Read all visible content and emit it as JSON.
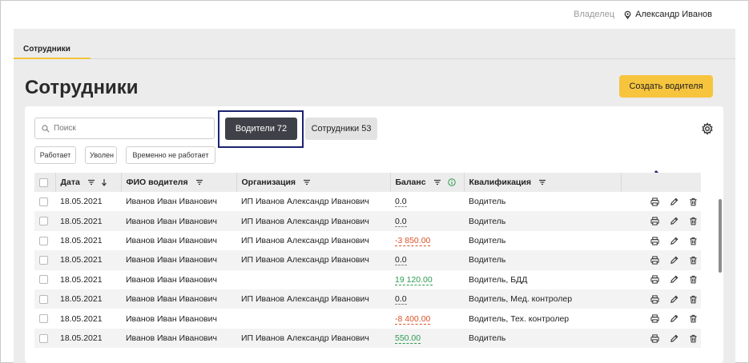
{
  "header": {
    "role": "Владелец",
    "user_name": "Александр Иванов"
  },
  "tabs": {
    "active_label": "Сотрудники"
  },
  "page": {
    "title": "Сотрудники",
    "create_label": "Создать водителя"
  },
  "search": {
    "placeholder": "Поиск"
  },
  "segments": {
    "drivers": "Водители 72",
    "staff": "Сотрудники 53"
  },
  "filters": [
    "Работает",
    "Уволен",
    "Временно не работает"
  ],
  "table": {
    "columns": [
      "Дата",
      "ФИО водителя",
      "Организация",
      "Баланс",
      "Квалификация"
    ],
    "rows": [
      {
        "date": "18.05.2021",
        "name": "Иванов Иван Иванович",
        "org": "ИП Иванов Александр Иванович",
        "balance": "0.0",
        "qual": "Водитель"
      },
      {
        "date": "18.05.2021",
        "name": "Иванов Иван Иванович",
        "org": "ИП Иванов Александр Иванович",
        "balance": "0.0",
        "qual": "Водитель"
      },
      {
        "date": "18.05.2021",
        "name": "Иванов Иван Иванович",
        "org": "ИП Иванов Александр Иванович",
        "balance": "-3 850.00",
        "qual": "Водитель"
      },
      {
        "date": "18.05.2021",
        "name": "Иванов Иван Иванович",
        "org": "ИП Иванов Александр Иванович",
        "balance": "0.0",
        "qual": "Водитель"
      },
      {
        "date": "18.05.2021",
        "name": "Иванов Иван Иванович",
        "org": "",
        "balance": "19 120.00",
        "qual": "Водитель, БДД"
      },
      {
        "date": "18.05.2021",
        "name": "Иванов Иван Иванович",
        "org": "ИП Иванов Александр Иванович",
        "balance": "0.0",
        "qual": "Водитель, Мед. контролер"
      },
      {
        "date": "18.05.2021",
        "name": "Иванов Иван Иванович",
        "org": "",
        "balance": "-8 400.00",
        "qual": "Водитель, Тех. контролер"
      },
      {
        "date": "18.05.2021",
        "name": "Иванов Иван Иванович",
        "org": "ИП Иванов Александр Иванович",
        "balance": "550.00",
        "qual": "Водитель"
      }
    ]
  },
  "icons": {
    "user": "location-pin-icon",
    "search": "search-icon",
    "settings": "gear-icon",
    "filter": "filter-icon",
    "sort": "sort-down-icon",
    "info": "info-icon",
    "print": "printer-icon",
    "edit": "pencil-icon",
    "delete": "trash-icon",
    "annotation": "arrow-down-right-icon"
  },
  "colors": {
    "accent": "#f7c43e",
    "active_segment": "#3e4147",
    "highlight": "#1c2270",
    "negative": "#d9532b",
    "positive": "#2e9b4f"
  }
}
